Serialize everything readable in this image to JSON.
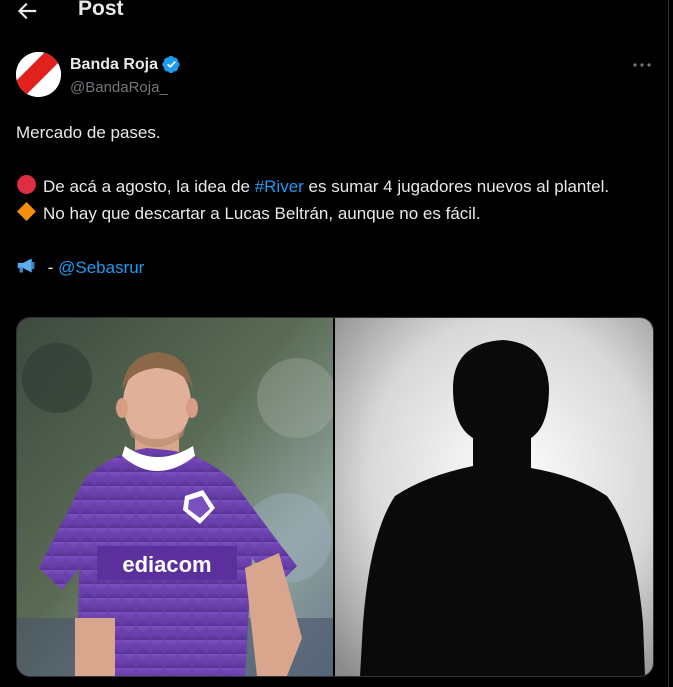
{
  "header": {
    "title": "Post",
    "back_icon": "arrow-left-icon"
  },
  "author": {
    "name": "Banda Roja",
    "handle": "@BandaRoja_",
    "verified_icon": "verified-badge-icon",
    "verified_color": "#1d9bf0"
  },
  "more_icon": "more-horizontal-icon",
  "tweet": {
    "line1": "Mercado de pases.",
    "p2": {
      "emoji": "red-circle-icon",
      "text_before": "De acá a agosto, la idea de ",
      "hashtag": "#River",
      "text_after": " es sumar 4 jugadores nuevos al plantel."
    },
    "p3": {
      "emoji": "orange-diamond-icon",
      "text": "No hay que descartar a Lucas Beltrán, aunque no es fácil."
    },
    "p4": {
      "emoji": "megaphone-icon",
      "dash": " - ",
      "mention": "@Sebasrur"
    }
  },
  "media": {
    "left_photo_text": "ediacom",
    "colors": {
      "link": "#1d9bf0",
      "jersey": "#6a3fa8"
    }
  }
}
